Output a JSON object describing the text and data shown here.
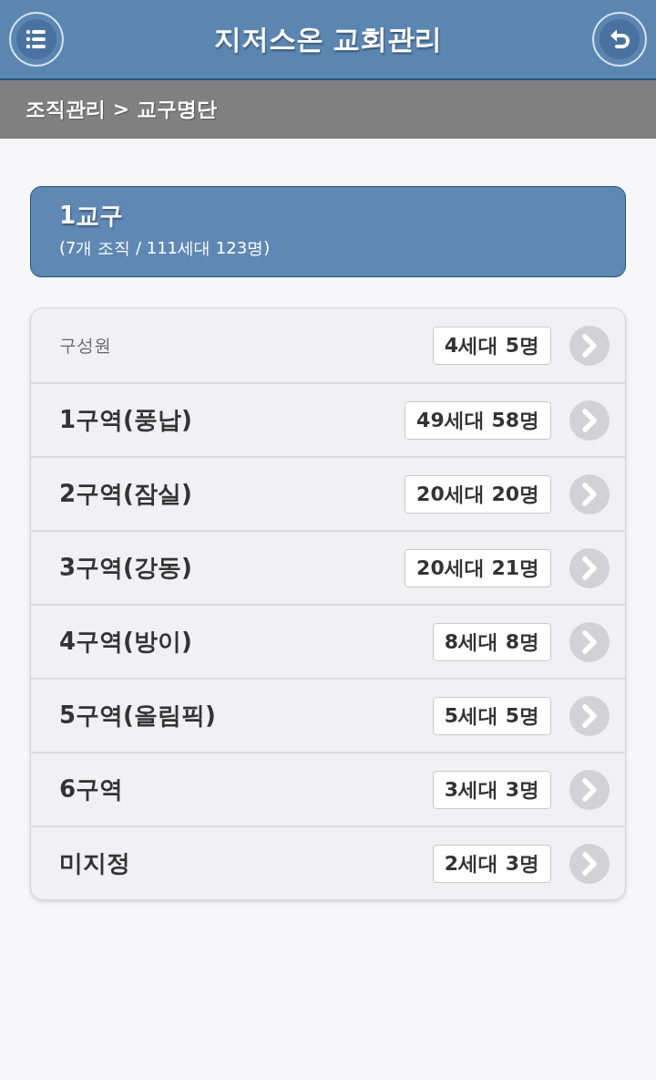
{
  "header": {
    "title": "지저스온 교회관리"
  },
  "breadcrumb": "조직관리 > 교구명단",
  "district": {
    "title": "1교구",
    "summary": "(7개 조직 / 111세대 123명)"
  },
  "groups": [
    {
      "kind": "members",
      "label": "구성원",
      "count": "4세대 5명"
    },
    {
      "kind": "area",
      "label": "1구역(풍납)",
      "count": "49세대 58명"
    },
    {
      "kind": "area",
      "label": "2구역(잠실)",
      "count": "20세대 20명"
    },
    {
      "kind": "area",
      "label": "3구역(강동)",
      "count": "20세대 21명"
    },
    {
      "kind": "area",
      "label": "4구역(방이)",
      "count": "8세대 8명"
    },
    {
      "kind": "area",
      "label": "5구역(올림픽)",
      "count": "5세대 5명"
    },
    {
      "kind": "area",
      "label": "6구역",
      "count": "3세대 3명"
    },
    {
      "kind": "area",
      "label": "미지정",
      "count": "2세대 3명"
    }
  ]
}
